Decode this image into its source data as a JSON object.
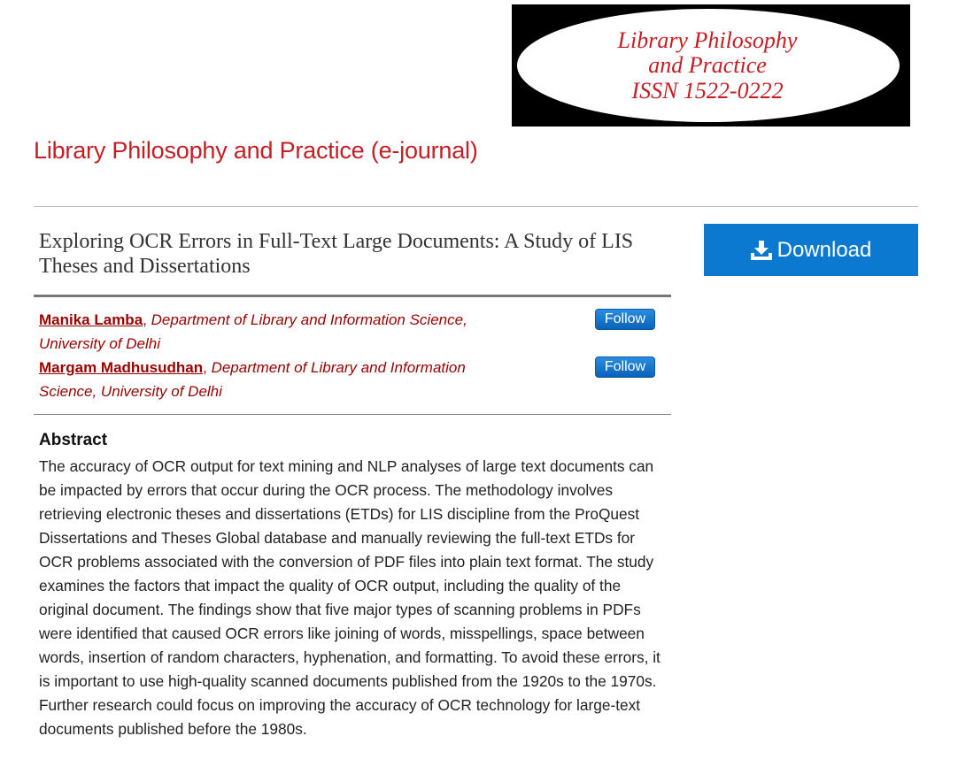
{
  "logo": {
    "line1": "Library Philosophy",
    "line2": "and Practice",
    "line3": "ISSN 1522-0222"
  },
  "journal": {
    "title": "Library Philosophy and Practice (e-journal)"
  },
  "article": {
    "title": "Exploring OCR Errors in Full-Text Large Documents: A Study of LIS Theses and Dissertations"
  },
  "download": {
    "label": "Download",
    "icon": "download-icon"
  },
  "authors": [
    {
      "name": "Manika Lamba",
      "affiliation": "Department of Library and Information Science, University of Delhi",
      "follow_label": "Follow"
    },
    {
      "name": "Margam Madhusudhan",
      "affiliation": "Department of Library and Information Science, University of Delhi",
      "follow_label": "Follow"
    }
  ],
  "abstract": {
    "heading": "Abstract",
    "text": "The accuracy of OCR output for text mining and NLP analyses of large text documents can be impacted by errors that occur during the OCR process. The methodology involves retrieving electronic theses and dissertations (ETDs) for LIS discipline from the ProQuest Dissertations and Theses Global database and manually reviewing the full-text ETDs for OCR problems associated with the conversion of PDF files into plain text format. The study examines the factors that impact the quality of OCR output, including the quality of the original document. The findings show that five major types of scanning problems in PDFs were identified that caused OCR errors like joining of words, misspellings, space between words, insertion of random characters, hyphenation, and formatting. To avoid these errors, it is important to use high-quality scanned documents published from the 1920s to the 1970s. Further research could focus on improving the accuracy of OCR technology for large-text documents published before the 1980s."
  },
  "colors": {
    "brand_red": "#c41e24",
    "author_red": "#990000",
    "download_blue": "#0b79d0"
  }
}
